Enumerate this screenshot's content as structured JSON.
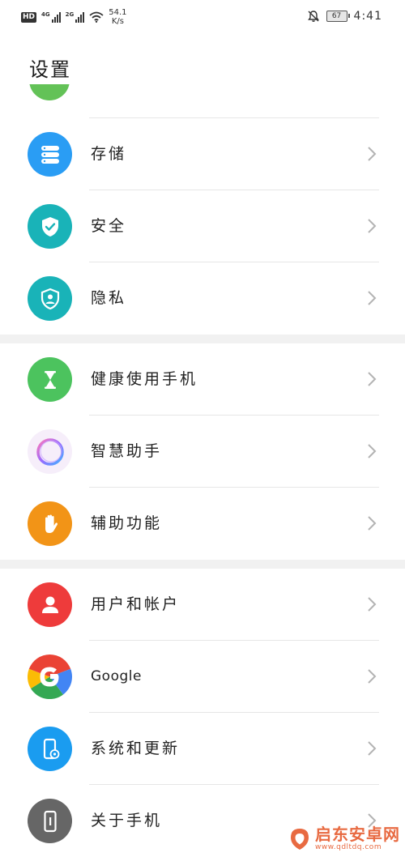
{
  "status_bar": {
    "hd_label": "HD",
    "net1": "4G",
    "net2": "2G",
    "speed_value": "54.1",
    "speed_unit": "K/s",
    "battery_level": "67",
    "time": "4:41",
    "icons": [
      "hd-icon",
      "signal-4g-icon",
      "signal-2g-icon",
      "wifi-icon",
      "mute-bell-icon",
      "battery-icon"
    ]
  },
  "page": {
    "title": "设置"
  },
  "groups": [
    [
      {
        "label": "存储",
        "icon": "storage-icon",
        "color": "#2a9df4"
      },
      {
        "label": "安全",
        "icon": "security-shield-icon",
        "color": "#19b3b8"
      },
      {
        "label": "隐私",
        "icon": "privacy-icon",
        "color": "#19b3b8"
      }
    ],
    [
      {
        "label": "健康使用手机",
        "icon": "hourglass-icon",
        "color": "#4cc35e"
      },
      {
        "label": "智慧助手",
        "icon": "assistant-ring-icon",
        "color": "#f6eefa"
      },
      {
        "label": "辅助功能",
        "icon": "hand-icon",
        "color": "#f29417"
      }
    ],
    [
      {
        "label": "用户和帐户",
        "icon": "user-icon",
        "color": "#ee3b3b"
      },
      {
        "label": "Google",
        "icon": "google-icon",
        "color": "#4285f4"
      },
      {
        "label": "系统和更新",
        "icon": "system-update-icon",
        "color": "#1a9cf0"
      },
      {
        "label": "关于手机",
        "icon": "phone-info-icon",
        "color": "#666666"
      }
    ]
  ],
  "watermark": {
    "name": "启东安卓网",
    "url": "www.qdltdq.com"
  }
}
